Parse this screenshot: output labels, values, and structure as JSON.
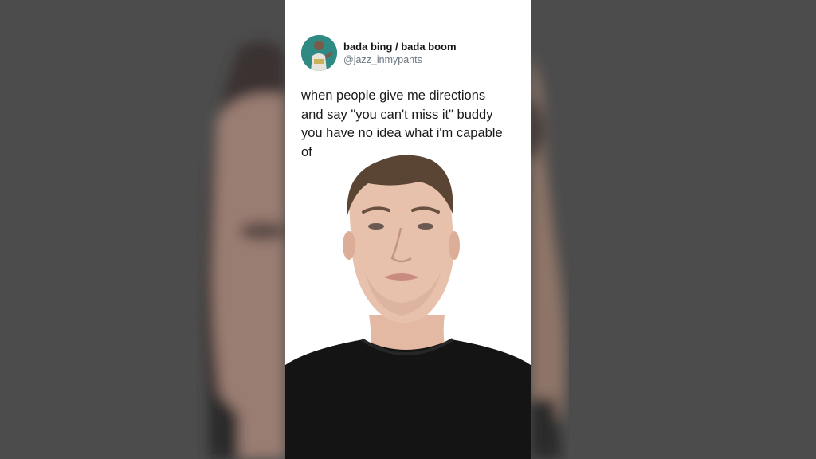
{
  "tweet": {
    "display_name": "bada bing / bada boom",
    "handle": "@jazz_inmypants",
    "text": "when people give me directions\nand say  \"you can't miss it\" buddy\nyou have no idea what i'm capable\nof"
  },
  "icons": {
    "avatar": "profile-photo-avatar"
  },
  "colors": {
    "background_gray": "#4b4b4b",
    "panel_white": "#ffffff",
    "shirt_black": "#141414",
    "skin": "#e7c2ad",
    "hair": "#5a4535"
  }
}
